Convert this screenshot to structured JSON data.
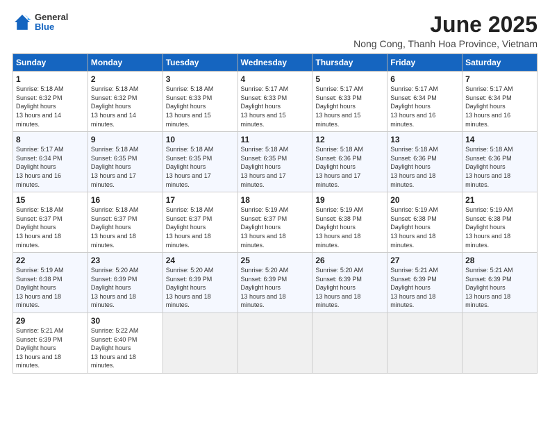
{
  "logo": {
    "general": "General",
    "blue": "Blue"
  },
  "header": {
    "title": "June 2025",
    "subtitle": "Nong Cong, Thanh Hoa Province, Vietnam"
  },
  "weekdays": [
    "Sunday",
    "Monday",
    "Tuesday",
    "Wednesday",
    "Thursday",
    "Friday",
    "Saturday"
  ],
  "weeks": [
    [
      {
        "day": 1,
        "sunrise": "5:18 AM",
        "sunset": "6:32 PM",
        "daylight": "13 hours and 14 minutes."
      },
      {
        "day": 2,
        "sunrise": "5:18 AM",
        "sunset": "6:32 PM",
        "daylight": "13 hours and 14 minutes."
      },
      {
        "day": 3,
        "sunrise": "5:18 AM",
        "sunset": "6:33 PM",
        "daylight": "13 hours and 15 minutes."
      },
      {
        "day": 4,
        "sunrise": "5:17 AM",
        "sunset": "6:33 PM",
        "daylight": "13 hours and 15 minutes."
      },
      {
        "day": 5,
        "sunrise": "5:17 AM",
        "sunset": "6:33 PM",
        "daylight": "13 hours and 15 minutes."
      },
      {
        "day": 6,
        "sunrise": "5:17 AM",
        "sunset": "6:34 PM",
        "daylight": "13 hours and 16 minutes."
      },
      {
        "day": 7,
        "sunrise": "5:17 AM",
        "sunset": "6:34 PM",
        "daylight": "13 hours and 16 minutes."
      }
    ],
    [
      {
        "day": 8,
        "sunrise": "5:17 AM",
        "sunset": "6:34 PM",
        "daylight": "13 hours and 16 minutes."
      },
      {
        "day": 9,
        "sunrise": "5:18 AM",
        "sunset": "6:35 PM",
        "daylight": "13 hours and 17 minutes."
      },
      {
        "day": 10,
        "sunrise": "5:18 AM",
        "sunset": "6:35 PM",
        "daylight": "13 hours and 17 minutes."
      },
      {
        "day": 11,
        "sunrise": "5:18 AM",
        "sunset": "6:35 PM",
        "daylight": "13 hours and 17 minutes."
      },
      {
        "day": 12,
        "sunrise": "5:18 AM",
        "sunset": "6:36 PM",
        "daylight": "13 hours and 17 minutes."
      },
      {
        "day": 13,
        "sunrise": "5:18 AM",
        "sunset": "6:36 PM",
        "daylight": "13 hours and 18 minutes."
      },
      {
        "day": 14,
        "sunrise": "5:18 AM",
        "sunset": "6:36 PM",
        "daylight": "13 hours and 18 minutes."
      }
    ],
    [
      {
        "day": 15,
        "sunrise": "5:18 AM",
        "sunset": "6:37 PM",
        "daylight": "13 hours and 18 minutes."
      },
      {
        "day": 16,
        "sunrise": "5:18 AM",
        "sunset": "6:37 PM",
        "daylight": "13 hours and 18 minutes."
      },
      {
        "day": 17,
        "sunrise": "5:18 AM",
        "sunset": "6:37 PM",
        "daylight": "13 hours and 18 minutes."
      },
      {
        "day": 18,
        "sunrise": "5:19 AM",
        "sunset": "6:37 PM",
        "daylight": "13 hours and 18 minutes."
      },
      {
        "day": 19,
        "sunrise": "5:19 AM",
        "sunset": "6:38 PM",
        "daylight": "13 hours and 18 minutes."
      },
      {
        "day": 20,
        "sunrise": "5:19 AM",
        "sunset": "6:38 PM",
        "daylight": "13 hours and 18 minutes."
      },
      {
        "day": 21,
        "sunrise": "5:19 AM",
        "sunset": "6:38 PM",
        "daylight": "13 hours and 18 minutes."
      }
    ],
    [
      {
        "day": 22,
        "sunrise": "5:19 AM",
        "sunset": "6:38 PM",
        "daylight": "13 hours and 18 minutes."
      },
      {
        "day": 23,
        "sunrise": "5:20 AM",
        "sunset": "6:39 PM",
        "daylight": "13 hours and 18 minutes."
      },
      {
        "day": 24,
        "sunrise": "5:20 AM",
        "sunset": "6:39 PM",
        "daylight": "13 hours and 18 minutes."
      },
      {
        "day": 25,
        "sunrise": "5:20 AM",
        "sunset": "6:39 PM",
        "daylight": "13 hours and 18 minutes."
      },
      {
        "day": 26,
        "sunrise": "5:20 AM",
        "sunset": "6:39 PM",
        "daylight": "13 hours and 18 minutes."
      },
      {
        "day": 27,
        "sunrise": "5:21 AM",
        "sunset": "6:39 PM",
        "daylight": "13 hours and 18 minutes."
      },
      {
        "day": 28,
        "sunrise": "5:21 AM",
        "sunset": "6:39 PM",
        "daylight": "13 hours and 18 minutes."
      }
    ],
    [
      {
        "day": 29,
        "sunrise": "5:21 AM",
        "sunset": "6:39 PM",
        "daylight": "13 hours and 18 minutes."
      },
      {
        "day": 30,
        "sunrise": "5:22 AM",
        "sunset": "6:40 PM",
        "daylight": "13 hours and 18 minutes."
      },
      null,
      null,
      null,
      null,
      null
    ]
  ],
  "labels": {
    "sunrise": "Sunrise:",
    "sunset": "Sunset:",
    "daylight": "Daylight hours"
  }
}
